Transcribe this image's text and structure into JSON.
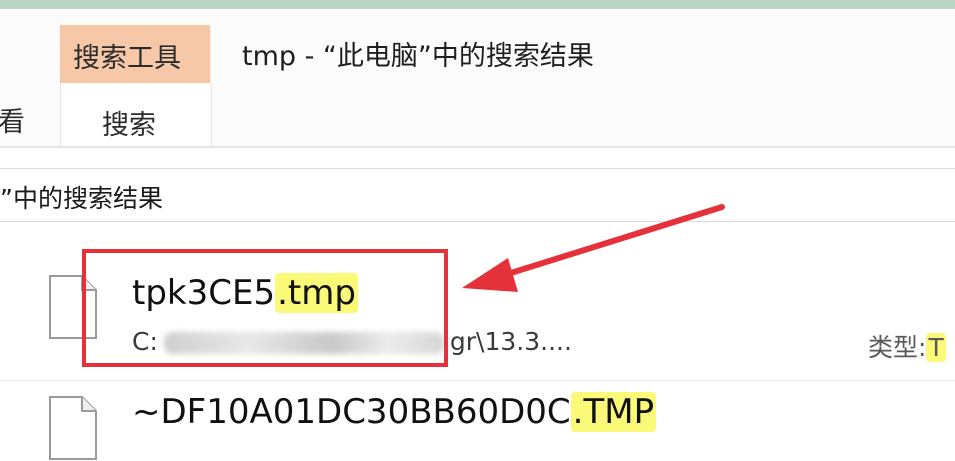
{
  "ribbon": {
    "partial_tab_label": "看",
    "context_tab_header": "搜索工具",
    "active_tab_label": "搜索"
  },
  "window": {
    "title": "tmp - “此电脑”中的搜索结果"
  },
  "address_bar": {
    "text": "”中的搜索结果"
  },
  "results": [
    {
      "name_prefix": "tpk3CE5",
      "name_match": ".tmp",
      "path_start": "C:",
      "path_end": "gr\\13.3....",
      "type_label": "类型:",
      "type_value": "T"
    },
    {
      "name_prefix": "~DF10A01DC30BB60D0C",
      "name_match": ".TMP"
    }
  ],
  "colors": {
    "context_tab": "#f7c8a8",
    "match_highlight": "#fafa78",
    "annotation_red": "#e5323a"
  }
}
